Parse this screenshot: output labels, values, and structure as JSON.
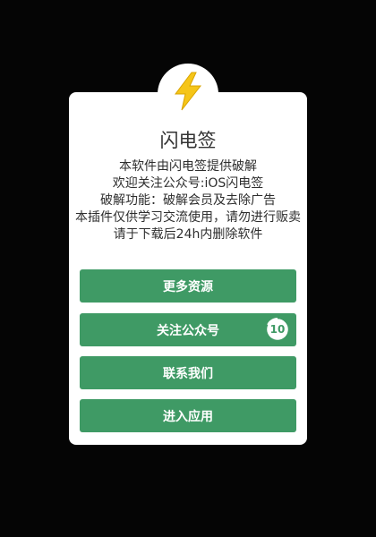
{
  "dialog": {
    "icon": "lightning-bolt-icon",
    "title": "闪电签",
    "lines": [
      "本软件由闪电签提供破解",
      "欢迎关注公众号:iOS闪电签",
      "破解功能：破解会员及去除广告",
      "本插件仅供学习交流使用，请勿进行贩卖",
      "请于下载后24h内删除软件"
    ],
    "buttons": {
      "more_resources": "更多资源",
      "follow_account": "关注公众号",
      "contact_us": "联系我们",
      "enter_app": "进入应用"
    },
    "countdown": "10"
  },
  "colors": {
    "button_green": "#3f9a65",
    "bolt_yellow": "#f5c518",
    "background": "#050505"
  }
}
